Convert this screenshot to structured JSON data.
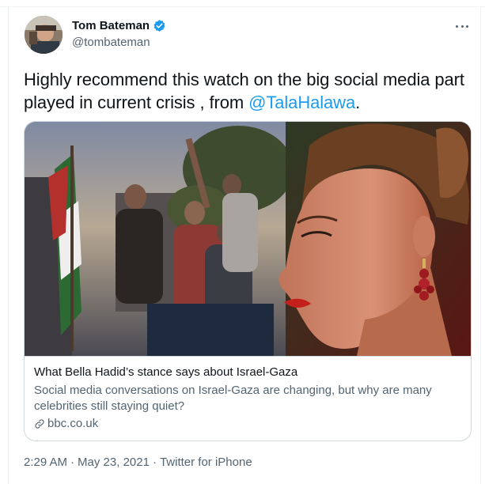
{
  "author": {
    "display_name": "Tom Bateman",
    "handle": "@tombateman",
    "verified_icon": "verified-badge-icon",
    "avatar_icon": "avatar-photo"
  },
  "tweet": {
    "text_before": "Highly recommend this watch on the big social media part played in current crisis , from ",
    "mention": "@TalaHalawa",
    "text_after": "."
  },
  "card": {
    "title": "What Bella Hadid’s stance says about Israel-Gaza",
    "description": "Social media conversations on Israel-Gaza are changing, but why are many celebrities still staying quiet?",
    "domain": "bbc.co.uk",
    "link_icon": "link-icon",
    "image": "news-photo"
  },
  "meta": {
    "time": "2:29 AM",
    "sep1": "·",
    "date": "May 23, 2021",
    "sep2": "·",
    "source": "Twitter for iPhone"
  },
  "colors": {
    "accent": "#1d9bf0",
    "text": "#0f1419",
    "secondary": "#536471",
    "border": "#cfd9de"
  }
}
